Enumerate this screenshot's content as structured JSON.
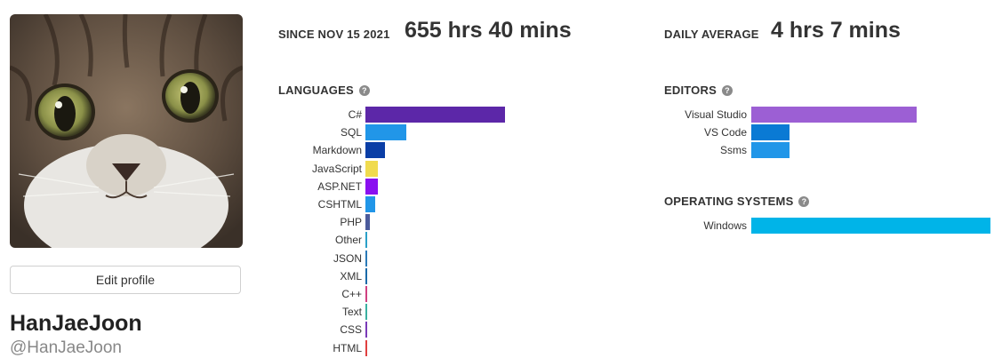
{
  "profile": {
    "display_name": "HanJaeJoon",
    "username": "@HanJaeJoon",
    "edit_label": "Edit profile"
  },
  "stats": {
    "since_label": "SINCE NOV 15 2021",
    "total_time": "655 hrs 40 mins",
    "daily_label": "DAILY AVERAGE",
    "daily_time": "4 hrs 7 mins"
  },
  "languages": {
    "title": "LANGUAGES",
    "items": [
      {
        "name": "C#",
        "share": 0.58,
        "color": "#5c27a8"
      },
      {
        "name": "SQL",
        "share": 0.17,
        "color": "#2196e8"
      },
      {
        "name": "Markdown",
        "share": 0.08,
        "color": "#0a3ea6"
      },
      {
        "name": "JavaScript",
        "share": 0.05,
        "color": "#f0db4f"
      },
      {
        "name": "ASP.NET",
        "share": 0.05,
        "color": "#8a10f0"
      },
      {
        "name": "CSHTML",
        "share": 0.04,
        "color": "#2196e8"
      },
      {
        "name": "PHP",
        "share": 0.02,
        "color": "#4b5b9c"
      },
      {
        "name": "Other",
        "share": 0.005,
        "color": "#2aa0c8"
      },
      {
        "name": "JSON",
        "share": 0.005,
        "color": "#2a7ab8"
      },
      {
        "name": "XML",
        "share": 0.005,
        "color": "#1a6aa8"
      },
      {
        "name": "C++",
        "share": 0.005,
        "color": "#d04080"
      },
      {
        "name": "Text",
        "share": 0.005,
        "color": "#3ab0a0"
      },
      {
        "name": "CSS",
        "share": 0.005,
        "color": "#7a3ab8"
      },
      {
        "name": "HTML",
        "share": 0.005,
        "color": "#e04040"
      }
    ]
  },
  "editors": {
    "title": "EDITORS",
    "items": [
      {
        "name": "Visual Studio",
        "share": 0.69,
        "color": "#9c5fd4"
      },
      {
        "name": "VS Code",
        "share": 0.16,
        "color": "#0a7ad4"
      },
      {
        "name": "Ssms",
        "share": 0.16,
        "color": "#2196e8"
      }
    ]
  },
  "os": {
    "title": "OPERATING SYSTEMS",
    "items": [
      {
        "name": "Windows",
        "share": 1.0,
        "color": "#00b4e8"
      }
    ]
  }
}
